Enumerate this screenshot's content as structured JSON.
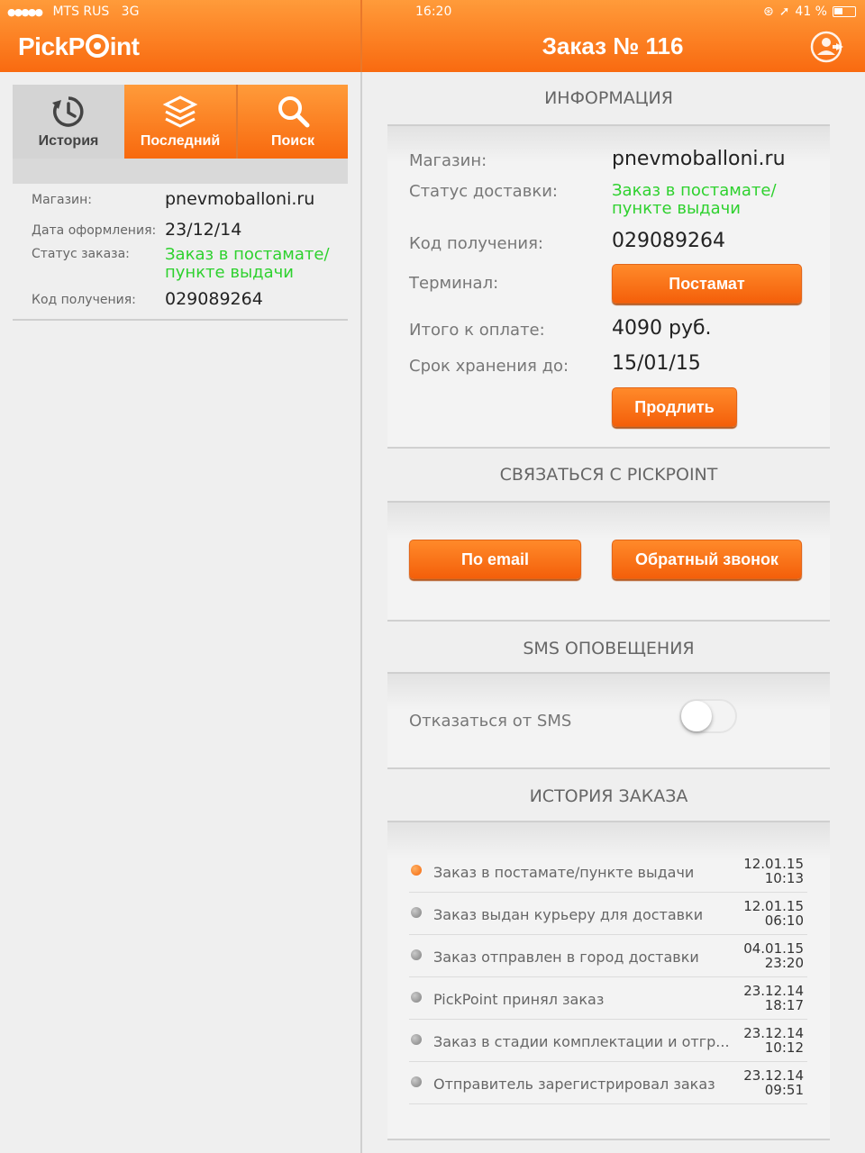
{
  "status_bar": {
    "carrier": "MTS RUS",
    "network": "3G",
    "time": "16:20",
    "battery": "41 %"
  },
  "app": {
    "logo_text_a": "PickP",
    "logo_text_b": "int",
    "title": "Заказ № 116"
  },
  "tabs": [
    {
      "label": "История",
      "icon": "history-icon",
      "active": true
    },
    {
      "label": "Последний",
      "icon": "layers-icon",
      "active": false
    },
    {
      "label": "Поиск",
      "icon": "search-icon",
      "active": false
    }
  ],
  "order_summary": [
    {
      "label": "Магазин:",
      "value": "pnevmoballoni.ru"
    },
    {
      "label": "Дата оформления:",
      "value": "23/12/14"
    },
    {
      "label": "Статус заказа:",
      "value_line1": "Заказ в постамате/",
      "value_line2": "пункте выдачи"
    },
    {
      "label": "Код получения:",
      "value": "029089264"
    }
  ],
  "info": {
    "heading": "ИНФОРМАЦИЯ",
    "shop_label": "Магазин:",
    "shop_value": "pnevmoballoni.ru",
    "status_label": "Статус доставки:",
    "status_line1": "Заказ в постамате/",
    "status_line2": "пункте выдачи",
    "code_label": "Код получения:",
    "code_value": "029089264",
    "terminal_label": "Терминал:",
    "terminal_button": "Постамат",
    "total_label": "Итого к оплате:",
    "total_value": "4090 руб.",
    "storage_label": "Срок хранения до:",
    "storage_value": "15/01/15",
    "extend_button": "Продлить"
  },
  "contact": {
    "heading": "СВЯЗАТЬСЯ С PICKPOINT",
    "email_button": "По email",
    "callback_button": "Обратный звонок"
  },
  "sms": {
    "heading": "SMS ОПОВЕЩЕНИЯ",
    "label": "Отказаться от SMS",
    "enabled": false
  },
  "history": {
    "heading": "ИСТОРИЯ ЗАКАЗА",
    "items": [
      {
        "text": "Заказ в постамате/пункте выдачи",
        "date": "12.01.15",
        "time": "10:13",
        "current": true
      },
      {
        "text": "Заказ выдан курьеру для доставки",
        "date": "12.01.15",
        "time": "06:10",
        "current": false
      },
      {
        "text": "Заказ отправлен в город доставки",
        "date": "04.01.15",
        "time": "23:20",
        "current": false
      },
      {
        "text": "PickPoint принял заказ",
        "date": "23.12.14",
        "time": "18:17",
        "current": false
      },
      {
        "text": "Заказ в стадии комплектации и отгр...",
        "date": "23.12.14",
        "time": "10:12",
        "current": false
      },
      {
        "text": "Отправитель зарегистрировал заказ",
        "date": "23.12.14",
        "time": "09:51",
        "current": false
      }
    ]
  },
  "colors": {
    "accent": "#f96a10",
    "status_green": "#2ed12e",
    "background": "#efefef"
  }
}
